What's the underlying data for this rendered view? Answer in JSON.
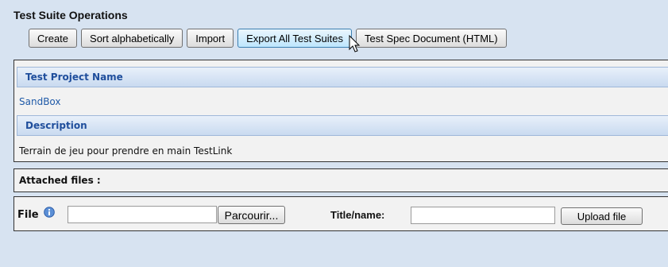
{
  "operations": {
    "title": "Test Suite Operations",
    "buttons": {
      "create": "Create",
      "sort": "Sort alphabetically",
      "import": "Import",
      "export": "Export All Test Suites",
      "spec": "Test Spec Document (HTML)"
    }
  },
  "project": {
    "name_header": "Test Project Name",
    "name_value": "SandBox",
    "description_header": "Description",
    "description_value": "Terrain de jeu pour prendre en main TestLink"
  },
  "attachments": {
    "label": "Attached files :"
  },
  "upload": {
    "file_label": "File",
    "browse_label": "Parcourir...",
    "title_label": "Title/name:",
    "title_value": "",
    "upload_label": "Upload file"
  },
  "colors": {
    "background": "#d7e3f1",
    "header_text": "#1f4e9c",
    "link": "#1f5aa8"
  }
}
